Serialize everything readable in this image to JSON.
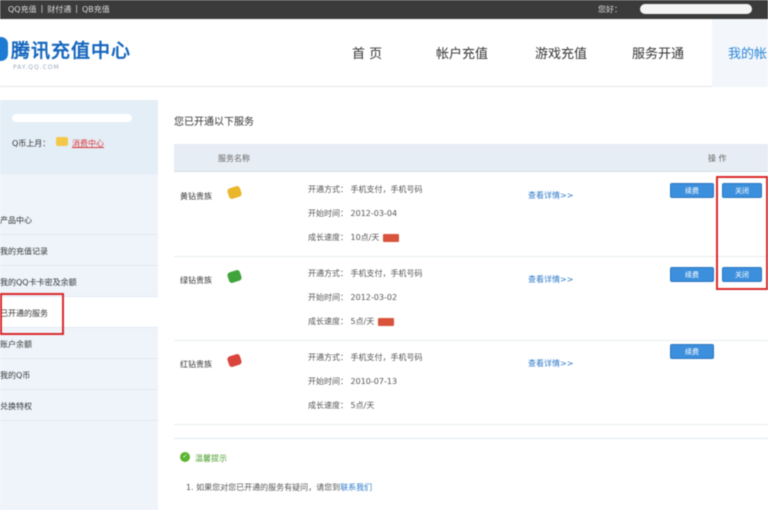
{
  "topbar": {
    "links": [
      "QQ充值",
      "财付通",
      "QB充值"
    ],
    "user_label": "您好："
  },
  "header": {
    "logo_title": "腾讯充值中心",
    "logo_sub": "PAY.QQ.COM",
    "nav": [
      "首 页",
      "帐户充值",
      "游戏充值",
      "服务开通",
      "我的帐"
    ]
  },
  "sidebar": {
    "balance_label": "Q币上月：",
    "recharge_link": "消费中心",
    "items": [
      "产品中心",
      "我的充值记录",
      "我的QQ卡卡密及余额",
      "已开通的服务",
      "账户余额",
      "我的Q币",
      "兑换特权"
    ]
  },
  "main": {
    "title": "您已开通以下服务",
    "col_name": "服务名称",
    "col_op": "操 作",
    "rows": [
      {
        "name": "黄钻贵族",
        "icon_color": "#e9b62c",
        "mode": "开通方式：  手机支付，手机号码",
        "start": "开始时间：  2012-03-04",
        "speed": "成长速度：  10点/天",
        "show_level": true,
        "detail": "查看详情>>",
        "btn_primary": "续费",
        "btn_secondary": "关闭"
      },
      {
        "name": "绿钻贵族",
        "icon_color": "#3fa53a",
        "mode": "开通方式：  手机支付，手机号码",
        "start": "开始时间：  2012-03-02",
        "speed": "成长速度：  5点/天",
        "show_level": true,
        "detail": "查看详情>>",
        "btn_primary": "续费",
        "btn_secondary": "关闭"
      },
      {
        "name": "红钻贵族",
        "icon_color": "#d9443c",
        "mode": "开通方式：  手机支付，手机号码",
        "start": "开始时间：  2010-07-13",
        "speed": "成长速度：  5点/天",
        "show_level": false,
        "detail": "查看详情>>",
        "btn_primary": "续费"
      }
    ],
    "tips_title": "温馨提示",
    "tips_text": "1. 如果您对您已开通的服务有疑问，请您到",
    "tips_contact": "联系我们"
  },
  "colors": {
    "accent": "#2a86d8",
    "highlight": "#d9292b",
    "button": "#3c8fdc"
  }
}
